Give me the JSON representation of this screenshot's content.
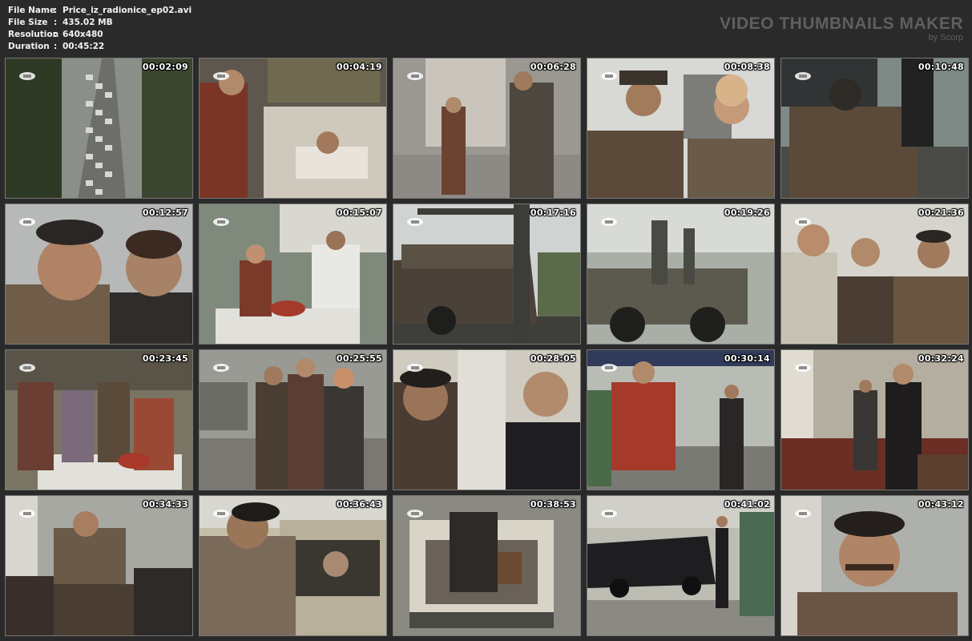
{
  "file_info": {
    "rows": [
      {
        "label": "File Name",
        "value": "Price_iz_radionice_ep02.avi"
      },
      {
        "label": "File Size",
        "value": "435.02 MB"
      },
      {
        "label": "Resolution",
        "value": "640x480"
      },
      {
        "label": "Duration",
        "value": "00:45:22"
      }
    ],
    "separator": ":"
  },
  "brand": {
    "title": "VIDEO THUMBNAILS MAKER",
    "subtitle": "by Scorp"
  },
  "thumbnails": [
    {
      "time": "00:02:09",
      "scene": "street-traffic"
    },
    {
      "time": "00:04:19",
      "scene": "bed-room"
    },
    {
      "time": "00:06:28",
      "scene": "street-walk"
    },
    {
      "time": "00:08:38",
      "scene": "man-woman-outdoor"
    },
    {
      "time": "00:10:48",
      "scene": "car-back"
    },
    {
      "time": "00:12:57",
      "scene": "closeup-two-men"
    },
    {
      "time": "00:15:07",
      "scene": "table-outdoor"
    },
    {
      "time": "00:17:16",
      "scene": "car-tow"
    },
    {
      "time": "00:19:26",
      "scene": "tow-truck"
    },
    {
      "time": "00:21:36",
      "scene": "group-men"
    },
    {
      "time": "00:23:45",
      "scene": "group-table"
    },
    {
      "time": "00:25:55",
      "scene": "street-group"
    },
    {
      "time": "00:28:05",
      "scene": "two-men-hall"
    },
    {
      "time": "00:30:14",
      "scene": "hotel-front"
    },
    {
      "time": "00:32:24",
      "scene": "lobby"
    },
    {
      "time": "00:34:33",
      "scene": "crowd-doorway"
    },
    {
      "time": "00:36:43",
      "scene": "car-window"
    },
    {
      "time": "00:38:53",
      "scene": "car-trunk"
    },
    {
      "time": "00:41:02",
      "scene": "black-car"
    },
    {
      "time": "00:43:12",
      "scene": "closeup-man"
    }
  ],
  "colors": {
    "background": "#2a2a2a",
    "brand_text": "#5f5f5f",
    "info_text": "#f2f2f2"
  }
}
